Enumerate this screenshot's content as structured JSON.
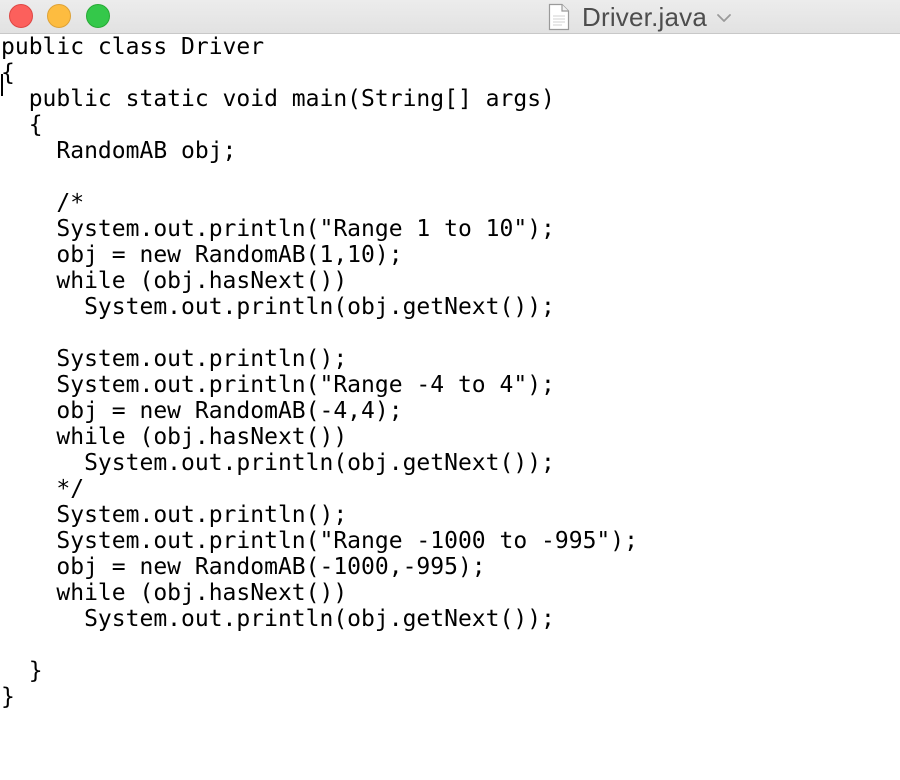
{
  "window": {
    "title": "Driver.java",
    "title_color": "#4d4d4d",
    "traffic_lights": {
      "close_color": "#fc605c",
      "minimize_color": "#fdbc40",
      "zoom_color": "#34c84a"
    }
  },
  "editor": {
    "lines": [
      "public class Driver",
      "{",
      "  public static void main(String[] args)",
      "  {",
      "    RandomAB obj;",
      "",
      "    /*",
      "    System.out.println(\"Range 1 to 10\");",
      "    obj = new RandomAB(1,10);",
      "    while (obj.hasNext())",
      "      System.out.println(obj.getNext());",
      "",
      "    System.out.println();",
      "    System.out.println(\"Range -4 to 4\");",
      "    obj = new RandomAB(-4,4);",
      "    while (obj.hasNext())",
      "      System.out.println(obj.getNext());",
      "    */",
      "    System.out.println();",
      "    System.out.println(\"Range -1000 to -995\");",
      "    obj = new RandomAB(-1000,-995);",
      "    while (obj.hasNext())",
      "      System.out.println(obj.getNext());",
      "",
      "  }",
      "}"
    ]
  }
}
